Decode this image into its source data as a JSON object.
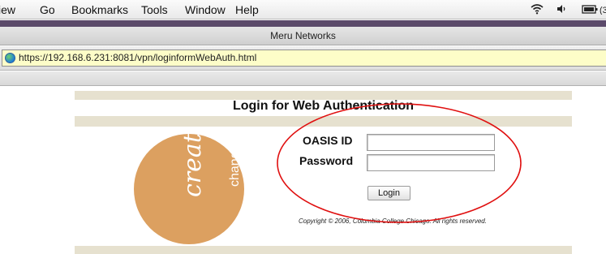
{
  "menubar": {
    "items": [
      "View",
      "Go",
      "Bookmarks",
      "Tools",
      "Window",
      "Help"
    ],
    "partial_first_label": "iew"
  },
  "window": {
    "title": "Meru Networks"
  },
  "address_bar": {
    "url": "https://192.168.6.231:8081/vpn/loginformWebAuth.html"
  },
  "page": {
    "title": "Login for Web Authentication",
    "logo": {
      "word_main": "create. . .",
      "word_secondary": "change"
    },
    "form": {
      "oasis_label": "OASIS ID",
      "password_label": "Password",
      "oasis_value": "",
      "password_value": "",
      "login_button": "Login"
    },
    "copyright": "Copyright © 2006, Columbia College Chicago. All rights reserved."
  },
  "colors": {
    "band": "#e6e1cf",
    "logo_bg": "#dca060",
    "annotation_ellipse": "#e01010",
    "address_bg": "#fdfdc8"
  },
  "icons": [
    "wifi-icon",
    "volume-icon",
    "battery-icon",
    "globe-icon",
    "rss-icon"
  ]
}
